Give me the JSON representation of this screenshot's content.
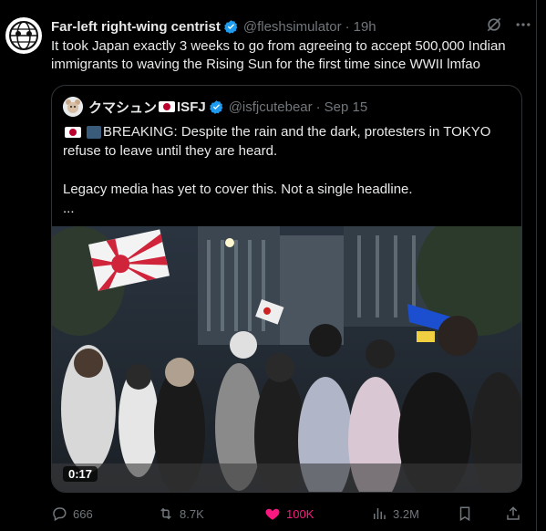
{
  "tweet": {
    "display_name": "Far-left right-wing centrist",
    "handle": "@fleshsimulator",
    "time": "19h",
    "text": "It took Japan exactly 3 weeks to go from agreeing to accept 500,000 Indian immigrants to waving the Rising Sun for the first time since WWII lmfao"
  },
  "quote": {
    "display_name": "クマシュン",
    "name_suffix": "ISFJ",
    "handle": "@isfjcutebear",
    "time": "Sep 15",
    "line1": "BREAKING: Despite the rain and the dark, protesters in TOKYO",
    "line2": "refuse to leave until they are heard.",
    "line3": "Legacy media has yet to cover this. Not a single headline.",
    "line4": "...",
    "video_duration": "0:17"
  },
  "actions": {
    "replies": "666",
    "reposts": "8.7K",
    "likes": "100K",
    "views": "3.2M"
  },
  "colors": {
    "background": "#000000",
    "text": "#e7e9ea",
    "muted": "#71767b",
    "verified": "#1d9bf0",
    "like": "#f91880",
    "border": "#2f3336"
  }
}
